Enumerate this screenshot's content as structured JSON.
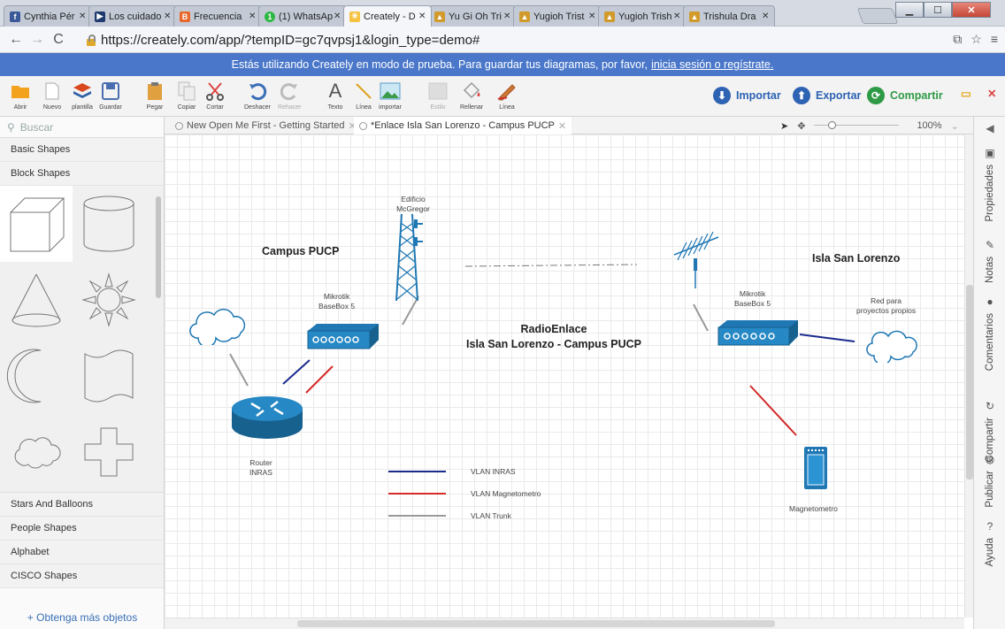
{
  "browser": {
    "tabs": [
      {
        "title": "Cynthia Pér",
        "fav_color": "#3b5998",
        "fav_glyph": "f"
      },
      {
        "title": "Los cuidado",
        "fav_color": "#1f3a6e",
        "fav_glyph": "▶"
      },
      {
        "title": "Frecuencia",
        "fav_color": "#e8672a",
        "fav_glyph": "B"
      },
      {
        "title": "(1) WhatsAp",
        "fav_color": "#2db742",
        "fav_glyph": "1"
      },
      {
        "title": "Creately - D",
        "fav_color": "#f5c242",
        "fav_glyph": "✳"
      },
      {
        "title": "Yu Gi Oh Tri",
        "fav_color": "#d19a2a",
        "fav_glyph": "▲"
      },
      {
        "title": "Yugioh Trist",
        "fav_color": "#d19a2a",
        "fav_glyph": "▲"
      },
      {
        "title": "Yugioh Trish",
        "fav_color": "#d19a2a",
        "fav_glyph": "▲"
      },
      {
        "title": "Trishula Dra",
        "fav_color": "#d19a2a",
        "fav_glyph": "▲"
      }
    ],
    "url": "https://creately.com/app/?tempID=gc7qvpsj1&login_type=demo#"
  },
  "banner": {
    "text": "Estás utilizando Creately en modo de prueba. Para guardar tus diagramas, por favor,",
    "link": "inicia sesión o regístrate."
  },
  "toolbar": {
    "abrir": "Abrir",
    "nuevo": "Nuevo",
    "plantilla": "plantilla",
    "guardar": "Guardar",
    "pegar": "Pegar",
    "copiar": "Copiar",
    "cortar": "Cortar",
    "deshacer": "Deshacer",
    "rehacer": "Rehacer",
    "texto": "Texto",
    "linea": "Línea",
    "importar_img": "importar",
    "estilo": "Estilo",
    "rellenar": "Rellenar",
    "linea2": "Línea",
    "importar": "Importar",
    "exportar": "Exportar",
    "compartir": "Compartir"
  },
  "sidebar": {
    "search_placeholder": "Buscar",
    "top_categories": [
      "Basic Shapes",
      "Block Shapes"
    ],
    "bottom_categories": [
      "Stars And Balloons",
      "People Shapes",
      "Alphabet",
      "CISCO Shapes"
    ],
    "more": "+ Obtenga más objetos"
  },
  "doc_tabs": [
    {
      "title": "New Open Me First - Getting Started",
      "active": false
    },
    {
      "title": "*Enlace Isla San Lorenzo - Campus PUCP",
      "active": true
    }
  ],
  "zoom": "100%",
  "right_panel": [
    "Propiedades",
    "Notas",
    "Comentarios",
    "Compartir",
    "Publicar",
    "Ayuda"
  ],
  "diagram": {
    "edificio": "Edificio\nMcGregor",
    "campus": "Campus PUCP",
    "isla": "Isla San Lorenzo",
    "mikrotik_left": "Mikrotik\nBaseBox 5",
    "mikrotik_right": "Mikrotik\nBaseBox 5",
    "radioenlace": "RadioEnlace\nIsla San Lorenzo - Campus PUCP",
    "red_propios": "Red para\nproyectos propios",
    "router": "Router\nINRAS",
    "magnetometro": "Magnetometro",
    "legend": [
      {
        "label": "VLAN INRAS",
        "color": "#1a2b8c"
      },
      {
        "label": "VLAN Magnetometro",
        "color": "#d42a2a"
      },
      {
        "label": "VLAN Trunk",
        "color": "#999999"
      }
    ],
    "accent": "#1f78b4"
  }
}
